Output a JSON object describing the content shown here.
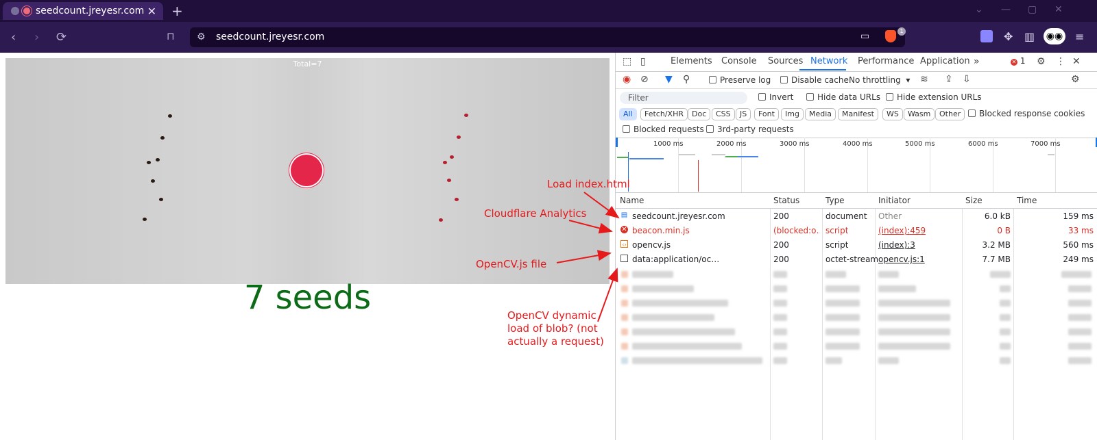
{
  "browser": {
    "tab_title": "seedcount.jreyesr.com",
    "url": "seedcount.jreyesr.com",
    "extension_badge": "1"
  },
  "page": {
    "overlay_total": "Total=7",
    "seed_count_text": "7 seeds"
  },
  "devtools": {
    "tabs": [
      "Elements",
      "Console",
      "Sources",
      "Network",
      "Performance",
      "Application"
    ],
    "active_tab": "Network",
    "error_count": "1",
    "toolbar": {
      "preserve_log": "Preserve log",
      "disable_cache": "Disable cache",
      "throttling": "No throttling"
    },
    "filter": {
      "placeholder": "Filter",
      "invert": "Invert",
      "hide_data_urls": "Hide data URLs",
      "hide_extension_urls": "Hide extension URLs"
    },
    "type_filters": [
      "All",
      "Fetch/XHR",
      "Doc",
      "CSS",
      "JS",
      "Font",
      "Img",
      "Media",
      "Manifest",
      "WS",
      "Wasm",
      "Other"
    ],
    "blocked_response_cookies": "Blocked response cookies",
    "blocked_requests": "Blocked requests",
    "third_party_requests": "3rd-party requests",
    "timeline_labels": [
      "1000 ms",
      "2000 ms",
      "3000 ms",
      "4000 ms",
      "5000 ms",
      "6000 ms",
      "7000 ms"
    ],
    "columns": [
      "Name",
      "Status",
      "Type",
      "Initiator",
      "Size",
      "Time"
    ],
    "requests": [
      {
        "name": "seedcount.jreyesr.com",
        "status": "200",
        "type": "document",
        "initiator": "Other",
        "size": "6.0 kB",
        "time": "159 ms",
        "icon": "document-icon",
        "error": false
      },
      {
        "name": "beacon.min.js",
        "status": "(blocked:o…",
        "type": "script",
        "initiator": "(index):459",
        "size": "0 B",
        "time": "33 ms",
        "icon": "error-icon",
        "error": true
      },
      {
        "name": "opencv.js",
        "status": "200",
        "type": "script",
        "initiator": "(index):3",
        "size": "3.2 MB",
        "time": "560 ms",
        "icon": "script-icon",
        "error": false
      },
      {
        "name": "data:application/oc…",
        "status": "200",
        "type": "octet-stream",
        "initiator": "opencv.js:1",
        "size": "7.7 MB",
        "time": "249 ms",
        "icon": "blank-file-icon",
        "error": false
      }
    ]
  },
  "annotations": {
    "load_index": "Load index.html",
    "cloudflare": "Cloudflare Analytics",
    "opencv_file": "OpenCV.js file",
    "opencv_blob_1": "OpenCV dynamic",
    "opencv_blob_2": "load of blob? (not",
    "opencv_blob_3": "actually a request)",
    "color": "#e6191b"
  }
}
